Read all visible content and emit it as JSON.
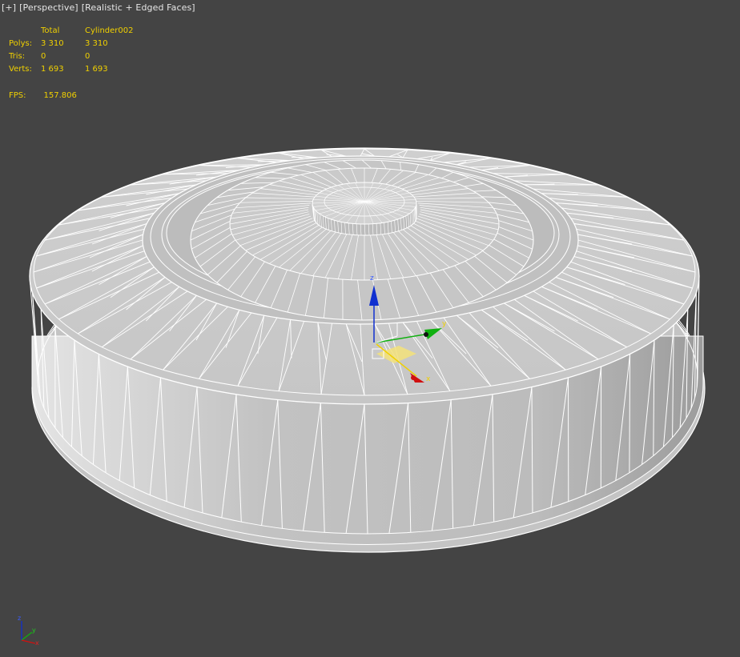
{
  "viewport": {
    "menu_label": "[+]",
    "view_label": "[Perspective]",
    "shading_label": "[Realistic + Edged Faces]"
  },
  "stats": {
    "header": {
      "col1": "Total",
      "col2": "Cylinder002"
    },
    "rows": [
      {
        "label": "Polys:",
        "total": "3 310",
        "selected": "3 310"
      },
      {
        "label": "Tris:",
        "total": "0",
        "selected": "0"
      },
      {
        "label": "Verts:",
        "total": "1 693",
        "selected": "1 693"
      }
    ],
    "fps_label": "FPS:",
    "fps_value": "157.806"
  },
  "gizmo": {
    "axis_x": "x",
    "axis_y": "y",
    "axis_z": "z",
    "x_color": "#d01010",
    "y_color": "#10b010",
    "z_color": "#1030d0"
  },
  "colors": {
    "background": "#444444",
    "mesh_fill": "#c8c8c8",
    "wire": "#ffffff",
    "stats_text": "#f0d000"
  }
}
